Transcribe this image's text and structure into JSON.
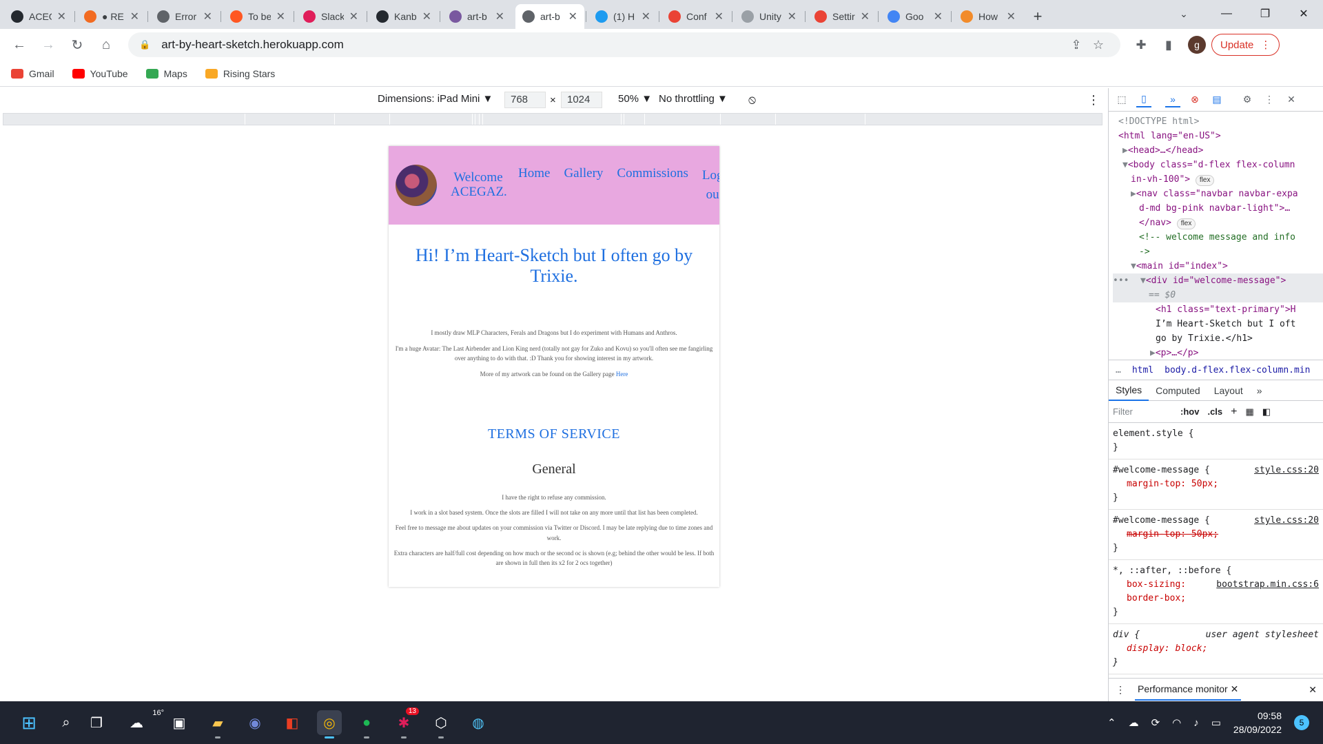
{
  "tabs": [
    {
      "title": "ACEG",
      "icon": "github-icon",
      "color": "#24292f"
    },
    {
      "title": "● RE",
      "icon": "grammarly-icon",
      "color": "#f26b21"
    },
    {
      "title": "Error",
      "icon": "globe-icon",
      "color": "#5f6368"
    },
    {
      "title": "To be",
      "icon": "todo-icon",
      "color": "#ff5722"
    },
    {
      "title": "Slack",
      "icon": "slack-icon",
      "color": "#e01e5a"
    },
    {
      "title": "Kanb",
      "icon": "github-icon",
      "color": "#24292f"
    },
    {
      "title": "art-b",
      "icon": "heroku-icon",
      "color": "#79589f"
    },
    {
      "title": "art-b",
      "icon": "globe-icon",
      "color": "#5f6368",
      "active": true
    },
    {
      "title": "(1) H",
      "icon": "twitter-icon",
      "color": "#1d9bf0"
    },
    {
      "title": "Conf",
      "icon": "gmail-icon",
      "color": "#ea4335"
    },
    {
      "title": "Unity",
      "icon": "unity-icon",
      "color": "#9aa0a6"
    },
    {
      "title": "Settir",
      "icon": "gmail-icon",
      "color": "#ea4335"
    },
    {
      "title": "Goo",
      "icon": "google-icon",
      "color": "#4285f4"
    },
    {
      "title": "How",
      "icon": "blog-icon",
      "color": "#f28b2a"
    }
  ],
  "address": {
    "url": "art-by-heart-sketch.herokuapp.com"
  },
  "toolbar": {
    "update_label": "Update",
    "profile_initial": "g"
  },
  "bookmarks": [
    {
      "label": "Gmail",
      "icon": "gmail-icon",
      "color": "#ea4335"
    },
    {
      "label": "YouTube",
      "icon": "youtube-icon",
      "color": "#ff0000"
    },
    {
      "label": "Maps",
      "icon": "maps-pin-icon",
      "color": "#34a853"
    },
    {
      "label": "Rising Stars",
      "icon": "star-icon",
      "color": "#f9a825"
    }
  ],
  "device_toolbar": {
    "dimensions_label": "Dimensions: iPad Mini",
    "width": "768",
    "height": "1024",
    "zoom": "50%",
    "throttling": "No throttling"
  },
  "site": {
    "welcome": "Welcome ACEGAZ.",
    "nav_links": [
      "Home",
      "Gallery",
      "Commissions"
    ],
    "logout": "Log out",
    "heading": "Hi! I’m Heart-Sketch but I often go by Trixie.",
    "intro": [
      "I mostly draw MLP Characters, Ferals and Dragons but I do experiment with Humans and Anthros.",
      "I'm a huge Avatar: The Last Airbender and Lion King nerd (totally not gay for Zuko and Kovu) so you'll often see me fangirling over anything to do with that. :D Thank you for showing interest in my artwork."
    ],
    "gallery_text": "More of my artwork can be found on the Gallery page",
    "gallery_link": "Here",
    "tos_title": "TERMS OF SERVICE",
    "general_title": "General",
    "general_items": [
      "I have the right to refuse any commission.",
      "I work in a slot based system. Once the slots are filled I will not take on any more until that list has been completed.",
      "Feel free to message me about updates on your commission via Twitter or Discord. I may be late replying due to time zones and work.",
      "Extra characters are half/full cost depending on how much or the second oc is shown (e.g; behind the other would be less. If both are shown in full then its x2 for 2 ocs together)"
    ]
  },
  "devtools": {
    "breadcrumbs": [
      "html",
      "body.d-flex.flex-column.min"
    ],
    "tabs": [
      "Styles",
      "Computed",
      "Layout"
    ],
    "filter_placeholder": "Filter",
    "filter_hov": ":hov",
    "filter_cls": ".cls",
    "dom": {
      "doctype": "<!DOCTYPE html>",
      "html_open": "<html lang=\"en-US\">",
      "head": "<head>…</head>",
      "body_open": "<body class=\"d-flex flex-column",
      "body_open2": "in-vh-100\">",
      "nav_open": "<nav class=\"navbar navbar-expa",
      "nav_open2": "d-md bg-pink navbar-light\">…",
      "nav_close": "</nav>",
      "comment": "<!-- welcome message and info",
      "comment2": "->",
      "main_open": "<main id=\"index\">",
      "div_open": "<div id=\"welcome-message\">",
      "div_eq": "== $0",
      "h1_open": "<h1 class=\"text-primary\">H",
      "h1_text": "I’m Heart-Sketch but I oft",
      "h1_text2": "go by Trixie.</h1>",
      "p_collapsed": "<p>…</p>",
      "flex_badge": "flex"
    },
    "rules": [
      {
        "selector": "element.style {",
        "source": "",
        "decl": "",
        "close": "}"
      },
      {
        "selector": "#welcome-message {",
        "source": "style.css:20",
        "decl": "margin-top: 50px;",
        "close": "}"
      },
      {
        "selector": "#welcome-message {",
        "source": "style.css:20",
        "decl": "margin-top: 50px;",
        "close": "}",
        "struck": true
      },
      {
        "selector": "*, ::after, ::before {",
        "source": "bootstrap.min.css:6",
        "decl": "box-sizing: border-box;",
        "close": "}"
      },
      {
        "selector": "div {",
        "source": "user agent stylesheet",
        "decl": "display: block;",
        "close": "}"
      }
    ],
    "drawer_tab": "Performance monitor"
  },
  "taskbar": {
    "weather": "16°",
    "slack_badge": "13",
    "time": "09:58",
    "date": "28/09/2022",
    "notifications": "5"
  }
}
